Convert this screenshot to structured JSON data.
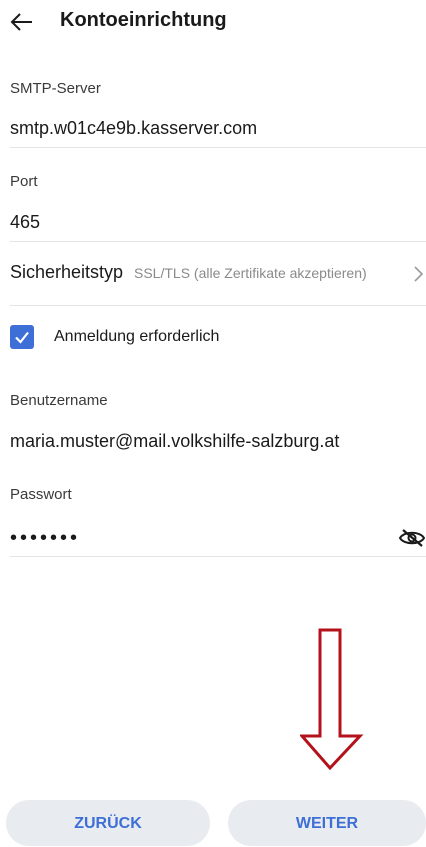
{
  "header": {
    "title": "Kontoeinrichtung",
    "back_icon": "arrow-left-icon"
  },
  "smtp": {
    "label": "SMTP-Server",
    "value": "smtp.w01c4e9b.kasserver.com"
  },
  "port": {
    "label": "Port",
    "value": "465"
  },
  "security": {
    "label": "Sicherheitstyp",
    "value": "SSL/TLS (alle Zertifikate akzeptieren)",
    "icon": "chevron-right-icon"
  },
  "login_required": {
    "label": "Anmeldung erforderlich",
    "checked": true
  },
  "username": {
    "label": "Benutzername",
    "value": "maria.muster@mail.volkshilfe-salzburg.at"
  },
  "password": {
    "label": "Passwort",
    "value": "•••••••",
    "toggle_icon": "eye-slash-icon"
  },
  "annotation": {
    "icon": "red-down-arrow",
    "color": "#b3121b"
  },
  "buttons": {
    "back_label": "ZURÜCK",
    "next_label": "WEITER"
  },
  "colors": {
    "accent": "#3d6fd6",
    "button_bg": "#e8ebef"
  }
}
